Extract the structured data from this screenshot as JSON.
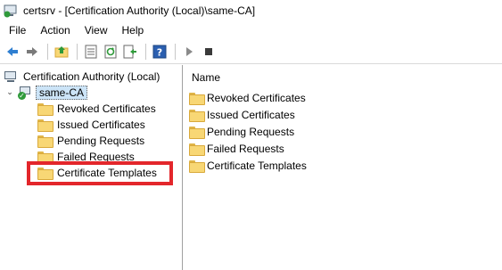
{
  "window": {
    "title": "certsrv - [Certification Authority (Local)\\same-CA]"
  },
  "menu": {
    "items": [
      "File",
      "Action",
      "View",
      "Help"
    ]
  },
  "toolbar": {
    "buttons": [
      "back-icon",
      "forward-icon",
      "up-folder-icon",
      "properties-icon",
      "refresh-icon",
      "export-list-icon",
      "help-icon",
      "start-service-icon",
      "stop-service-icon"
    ]
  },
  "tree": {
    "root": "Certification Authority (Local)",
    "ca": "same-CA",
    "children": [
      "Revoked Certificates",
      "Issued Certificates",
      "Pending Requests",
      "Failed Requests",
      "Certificate Templates"
    ],
    "highlighted": "Certificate Templates"
  },
  "list": {
    "column_header": "Name",
    "items": [
      "Revoked Certificates",
      "Issued Certificates",
      "Pending Requests",
      "Failed Requests",
      "Certificate Templates"
    ]
  },
  "colors": {
    "highlight_box": "#e3262b",
    "selection": "#cce4f7",
    "folder": "#f8d775"
  }
}
